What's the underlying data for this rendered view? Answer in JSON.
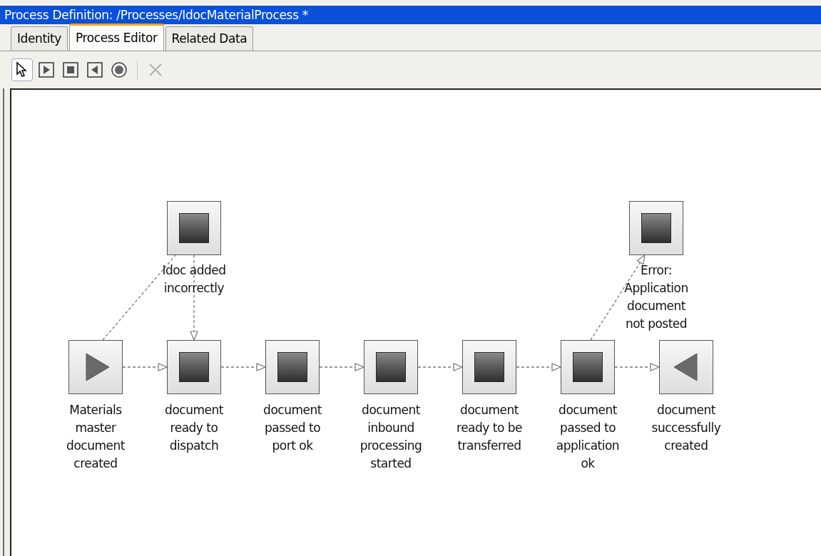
{
  "window": {
    "title": "Process Definition: /Processes/IdocMaterialProcess *"
  },
  "tabs": [
    {
      "label": "Identity",
      "selected": false
    },
    {
      "label": "Process Editor",
      "selected": true
    },
    {
      "label": "Related Data",
      "selected": false
    }
  ],
  "toolbar": {
    "tools": [
      {
        "kind": "select",
        "selected": true,
        "disabled": false
      },
      {
        "kind": "start",
        "selected": false,
        "disabled": false
      },
      {
        "kind": "task",
        "selected": false,
        "disabled": false
      },
      {
        "kind": "end",
        "selected": false,
        "disabled": false
      },
      {
        "kind": "event",
        "selected": false,
        "disabled": false
      },
      {
        "kind": "delete",
        "selected": false,
        "disabled": true
      }
    ]
  },
  "process": {
    "nodes": [
      {
        "kind": "start",
        "label": "Materials master document created"
      },
      {
        "kind": "task",
        "label": "document ready to dispatch"
      },
      {
        "kind": "task",
        "label": "document passed to port ok"
      },
      {
        "kind": "task",
        "label": "document inbound processing started"
      },
      {
        "kind": "task",
        "label": "document ready to be transferred"
      },
      {
        "kind": "task",
        "label": "document passed to application ok"
      },
      {
        "kind": "end",
        "label": "document successfully created"
      }
    ],
    "exception_nodes": [
      {
        "kind": "task",
        "label": "Idoc added incorrectly"
      },
      {
        "kind": "task",
        "label": "Error: Application document not posted"
      }
    ]
  }
}
